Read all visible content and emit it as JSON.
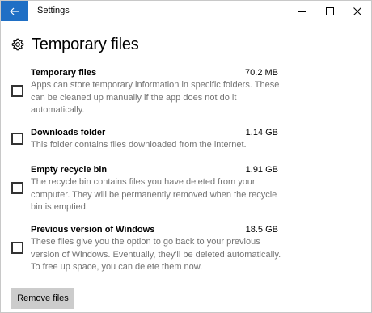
{
  "window": {
    "title": "Settings"
  },
  "page": {
    "title": "Temporary files"
  },
  "items": [
    {
      "name": "Temporary files",
      "size": "70.2 MB",
      "description": "Apps can store temporary information in specific folders. These can be cleaned up manually if the app does not do it automatically.",
      "checked": false
    },
    {
      "name": "Downloads folder",
      "size": "1.14 GB",
      "description": "This folder contains files downloaded from the internet.",
      "checked": false
    },
    {
      "name": "Empty recycle bin",
      "size": "1.91 GB",
      "description": "The recycle bin contains files you have deleted from your computer. They will be permanently removed when the recycle bin is emptied.",
      "checked": false
    },
    {
      "name": "Previous version of Windows",
      "size": "18.5 GB",
      "description": "These files give you the option to go back to your previous version of Windows. Eventually, they'll be deleted automatically. To free up space, you can delete them now.",
      "checked": false
    }
  ],
  "actions": {
    "remove_label": "Remove files"
  },
  "colors": {
    "accent": "#1f6fc5",
    "description_text": "#737373",
    "button_bg": "#cccccc"
  },
  "icons": {
    "back": "back-arrow-icon",
    "header": "gear-icon",
    "minimize": "minimize-icon",
    "maximize": "maximize-icon",
    "close": "close-icon"
  }
}
